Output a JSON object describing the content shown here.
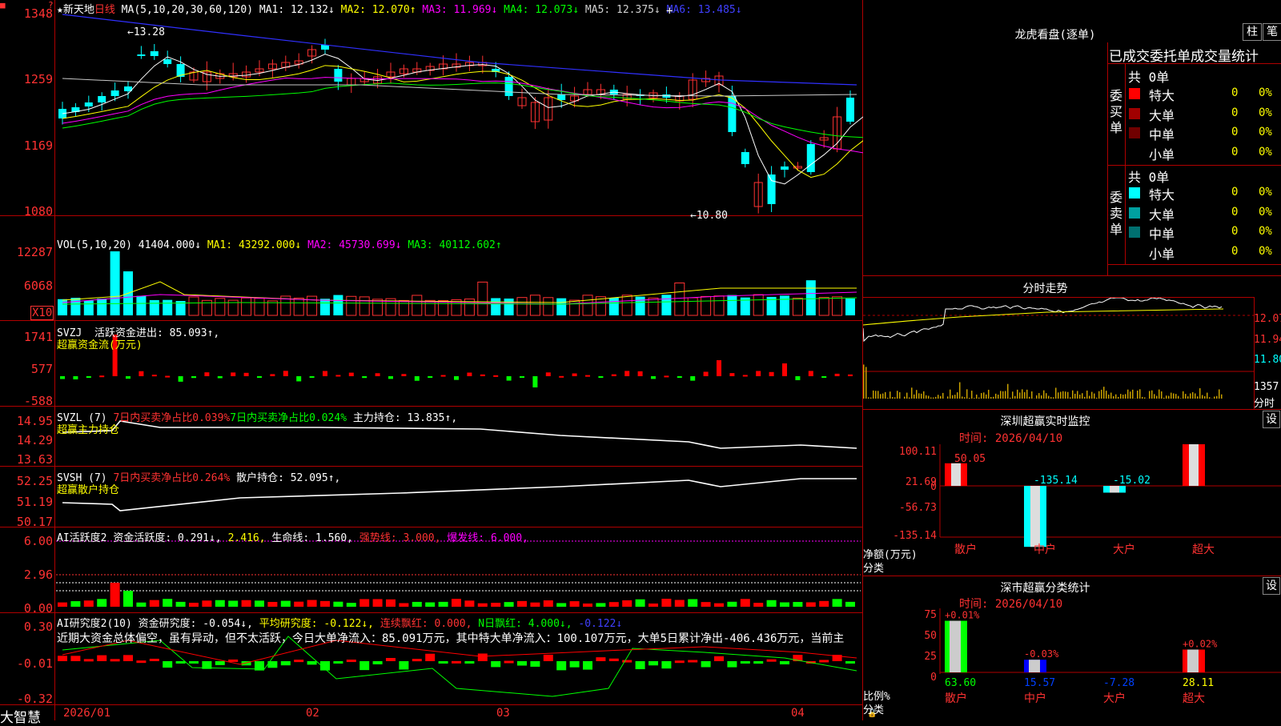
{
  "app": {
    "corner": "■",
    "corner2": "?",
    "brand": "大智慧",
    "lock": "🔒",
    "cross": "+"
  },
  "main": {
    "title": "★新天地",
    "period": "日线",
    "ma_label": "MA(5,10,20,30,60,120)",
    "ma_items": [
      {
        "t": "MA1: 12.132↓",
        "c": "#ffffff"
      },
      {
        "t": "MA2: 12.070↑",
        "c": "#ffff00"
      },
      {
        "t": "MA3: 11.969↓",
        "c": "#ff00ff"
      },
      {
        "t": "MA4: 12.073↓",
        "c": "#00ff00"
      },
      {
        "t": "MA5: 12.375↓",
        "c": "#d0d0d0"
      },
      {
        "t": "MA6: 13.485↓",
        "c": "#4040ff"
      }
    ],
    "yticks": [
      "1348",
      "1259",
      "1169",
      "1080"
    ],
    "hi_label": "13.28",
    "lo_label": "10.80"
  },
  "vol": {
    "label": "VOL(5,10,20)",
    "items": [
      {
        "t": "41404.000↓",
        "c": "#fff"
      },
      {
        "t": "MA1: 43292.000↓",
        "c": "#ffff00"
      },
      {
        "t": "MA2: 45730.699↓",
        "c": "#ff00ff"
      },
      {
        "t": "MA3: 40112.602↑",
        "c": "#00ff00"
      }
    ],
    "yticks": [
      "12287",
      "6068"
    ],
    "unit": "X10"
  },
  "svzj": {
    "label": "SVZJ",
    "l1": "活跃资金进出: 85.093↑,",
    "l2": "超赢资金流(万元)",
    "yticks": [
      "1741",
      "577",
      "-588"
    ]
  },
  "svzl": {
    "label": "SVZL (7)",
    "a": "7日内买卖净占比0.039%",
    "b": "7日内买卖净占比0.024%",
    "c": "主力持仓: 13.835↑,",
    "l2": "超赢主力持仓",
    "yticks": [
      "14.95",
      "14.29",
      "13.63"
    ]
  },
  "svsh": {
    "label": "SVSH (7)",
    "a": "7日内买卖净占比0.264%",
    "c": "散户持仓: 52.095↑,",
    "l2": "超赢散户持仓",
    "yticks": [
      "52.25",
      "51.19",
      "50.17"
    ]
  },
  "ai1": {
    "label": "AI活跃度2",
    "a": "资金活跃度: 0.291↓,",
    "b": "2.416,",
    "c": "生命线: 1.560,",
    "d": "强势线: 3.000,",
    "e": "爆发线: 6.000,",
    "yticks": [
      "6.00",
      "2.96",
      "0.00"
    ]
  },
  "ai2": {
    "label": "AI研究度2(10)",
    "a": "资金研究度: -0.054↓,",
    "b": "平均研究度: -0.122↓,",
    "c": "连续飘红: 0.000,",
    "d": "N日飘红: 4.000↓,",
    "e": "-0.122↓",
    "text": "近期大资金总体偏空，虽有异动，但不太活跃，今日大单净流入：85.091万元，其中特大单净流入：100.107万元，大单5日累计净出-406.436万元，当前主",
    "yticks": [
      "0.30",
      "-0.01",
      "-0.32"
    ]
  },
  "dates": [
    "2026/01",
    "02",
    "03",
    "04"
  ],
  "right": {
    "dragon": {
      "title": "龙虎看盘(逐单)",
      "btn1": "柱",
      "btn2": "笔",
      "header": "已成交委托单成交量统计",
      "buy": {
        "side": "委买单",
        "total": "共 0单",
        "rows": [
          {
            "n": "特大",
            "c": "#ff0000",
            "v": "0",
            "p": "0%"
          },
          {
            "n": "大单",
            "c": "#a00000",
            "v": "0",
            "p": "0%"
          },
          {
            "n": "中单",
            "c": "#700000",
            "v": "0",
            "p": "0%"
          },
          {
            "n": "小单",
            "c": "#000000",
            "v": "0",
            "p": "0%"
          }
        ]
      },
      "sell": {
        "side": "委卖单",
        "total": "共 0单",
        "rows": [
          {
            "n": "特大",
            "c": "#00ffff",
            "v": "0",
            "p": "0%"
          },
          {
            "n": "大单",
            "c": "#00a0a0",
            "v": "0",
            "p": "0%"
          },
          {
            "n": "中单",
            "c": "#007070",
            "v": "0",
            "p": "0%"
          },
          {
            "n": "小单",
            "c": "#000000",
            "v": "0",
            "p": "0%"
          }
        ]
      }
    },
    "intraday": {
      "title": "分时走势",
      "y": [
        "12.07",
        "11.94",
        "11.80"
      ],
      "vol": "1357",
      "vlabel": "分时"
    },
    "monitor": {
      "title": "深圳超赢实时监控",
      "btn": "设",
      "time": "时间: 2026/04/10",
      "yticks": [
        "100.11",
        "21.69",
        "0",
        "-56.73",
        "-135.14"
      ],
      "ylabel": "净额(万元)",
      "xlabel": "分类",
      "cats": [
        "散户",
        "中户",
        "大户",
        "超大"
      ],
      "values": [
        50.05,
        -135.14,
        -15.02,
        100.11
      ],
      "labels": [
        "50.05",
        "-135.14",
        "-15.02",
        "100.11"
      ]
    },
    "stats": {
      "title": "深市超赢分类统计",
      "btn": "设",
      "time": "时间: 2026/04/10",
      "yticks": [
        "75",
        "50",
        "25",
        "0"
      ],
      "ylabel": "比例%",
      "xlabel": "分类",
      "cats": [
        "散户",
        "中户",
        "大户",
        "超大"
      ],
      "values": [
        63.6,
        15.57,
        -7.28,
        28.11
      ],
      "pct": [
        "+0.01%",
        "-0.03%",
        "",
        "+0.02%"
      ],
      "labels": [
        "63.60",
        "15.57",
        "-7.28",
        "28.11"
      ]
    }
  }
}
